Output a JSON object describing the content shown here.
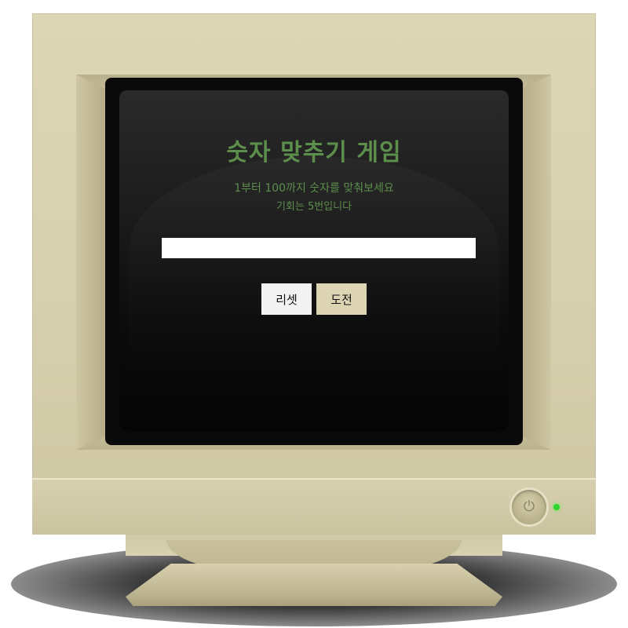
{
  "game": {
    "title": "숫자 맞추기 게임",
    "instructions": "1부터 100까지 숫자를 맞춰보세요",
    "chances": "기회는 5번입니다",
    "input_value": "",
    "input_placeholder": ""
  },
  "buttons": {
    "reset_label": "리셋",
    "challenge_label": "도전"
  },
  "colors": {
    "accent_text": "#5c8f4c",
    "monitor_beige": "#d6cfad",
    "screen_black": "#0a0a0a",
    "power_led": "#2fd42f"
  },
  "icons": {
    "power": "power-icon"
  }
}
